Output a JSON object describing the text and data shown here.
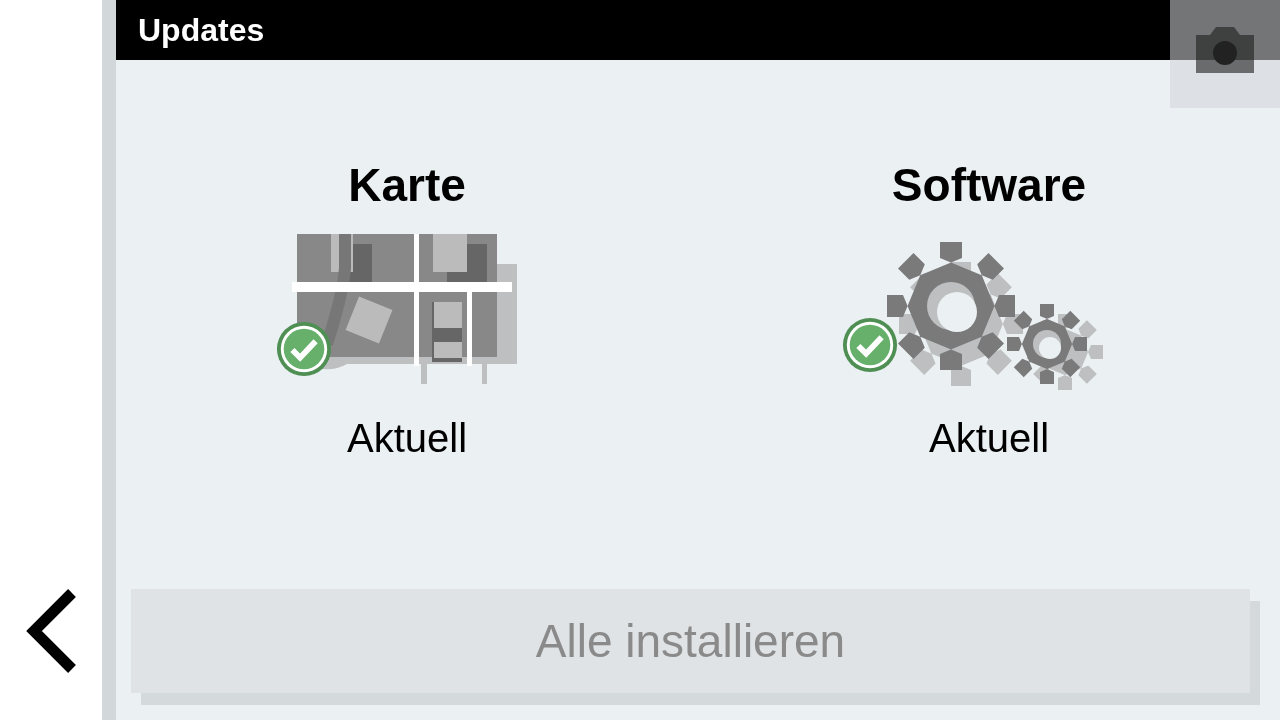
{
  "header": {
    "title": "Updates"
  },
  "updates": [
    {
      "kind": "map",
      "title": "Karte",
      "status": "Aktuell",
      "up_to_date": true
    },
    {
      "kind": "software",
      "title": "Software",
      "status": "Aktuell",
      "up_to_date": true
    }
  ],
  "install_button": {
    "label": "Alle installieren",
    "disabled": true
  }
}
